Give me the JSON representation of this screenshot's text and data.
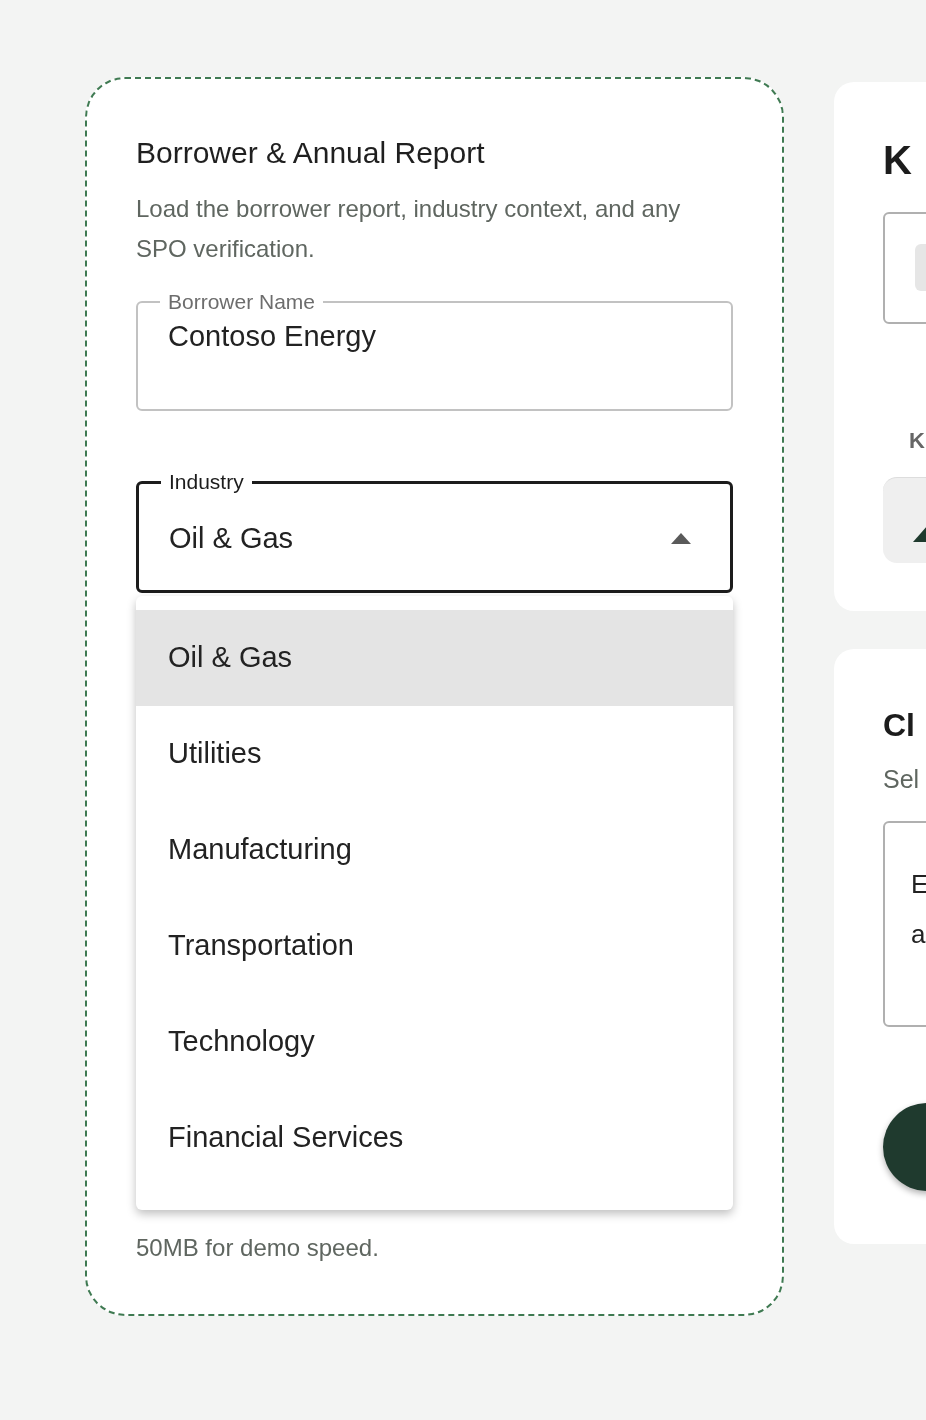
{
  "borrower_card": {
    "title": "Borrower & Annual Report",
    "description": "Load the borrower report, industry context, and any SPO verification.",
    "borrower_name": {
      "label": "Borrower Name",
      "value": "Contoso Energy"
    },
    "industry": {
      "label": "Industry",
      "value": "Oil & Gas",
      "expanded": true,
      "options": [
        {
          "label": "Oil & Gas",
          "selected": true
        },
        {
          "label": "Utilities",
          "selected": false
        },
        {
          "label": "Manufacturing",
          "selected": false
        },
        {
          "label": "Transportation",
          "selected": false
        },
        {
          "label": "Technology",
          "selected": false
        },
        {
          "label": "Financial Services",
          "selected": false
        }
      ]
    },
    "note": "50MB for demo speed."
  },
  "kpi_card": {
    "title": "K",
    "subheading": "K"
  },
  "second_card": {
    "title": "Cl",
    "description": "Sel",
    "field_lines": [
      "E",
      "a"
    ]
  }
}
